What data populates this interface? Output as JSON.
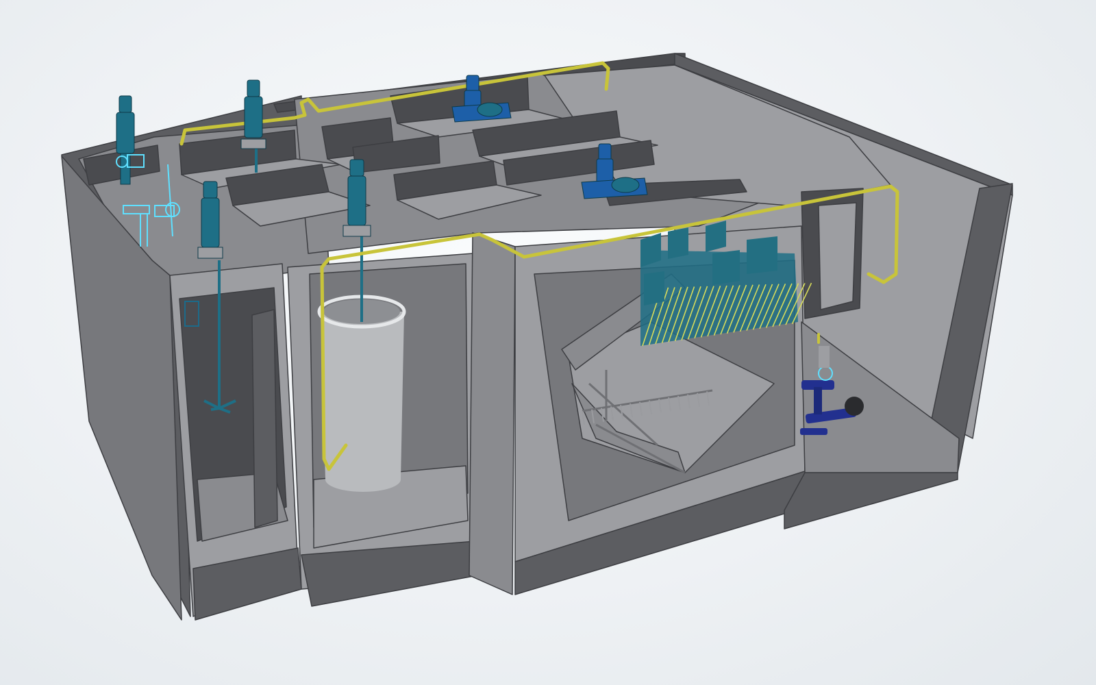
{
  "model": {
    "colors": {
      "background": "#eef1f4",
      "concrete_top": "#8a8b8f",
      "concrete_front": "#77787c",
      "concrete_side": "#5c5d61",
      "concrete_dark": "#4a4b4f",
      "concrete_light": "#9d9ea2",
      "glass_tank": "#b9bbbe",
      "yellow_pipe": "#c8c43a",
      "equipment_teal": "#1e6f86",
      "equipment_blue": "#1d5fa8",
      "pump_navy": "#22308f",
      "highlight_cyan": "#5fe0ff"
    }
  }
}
